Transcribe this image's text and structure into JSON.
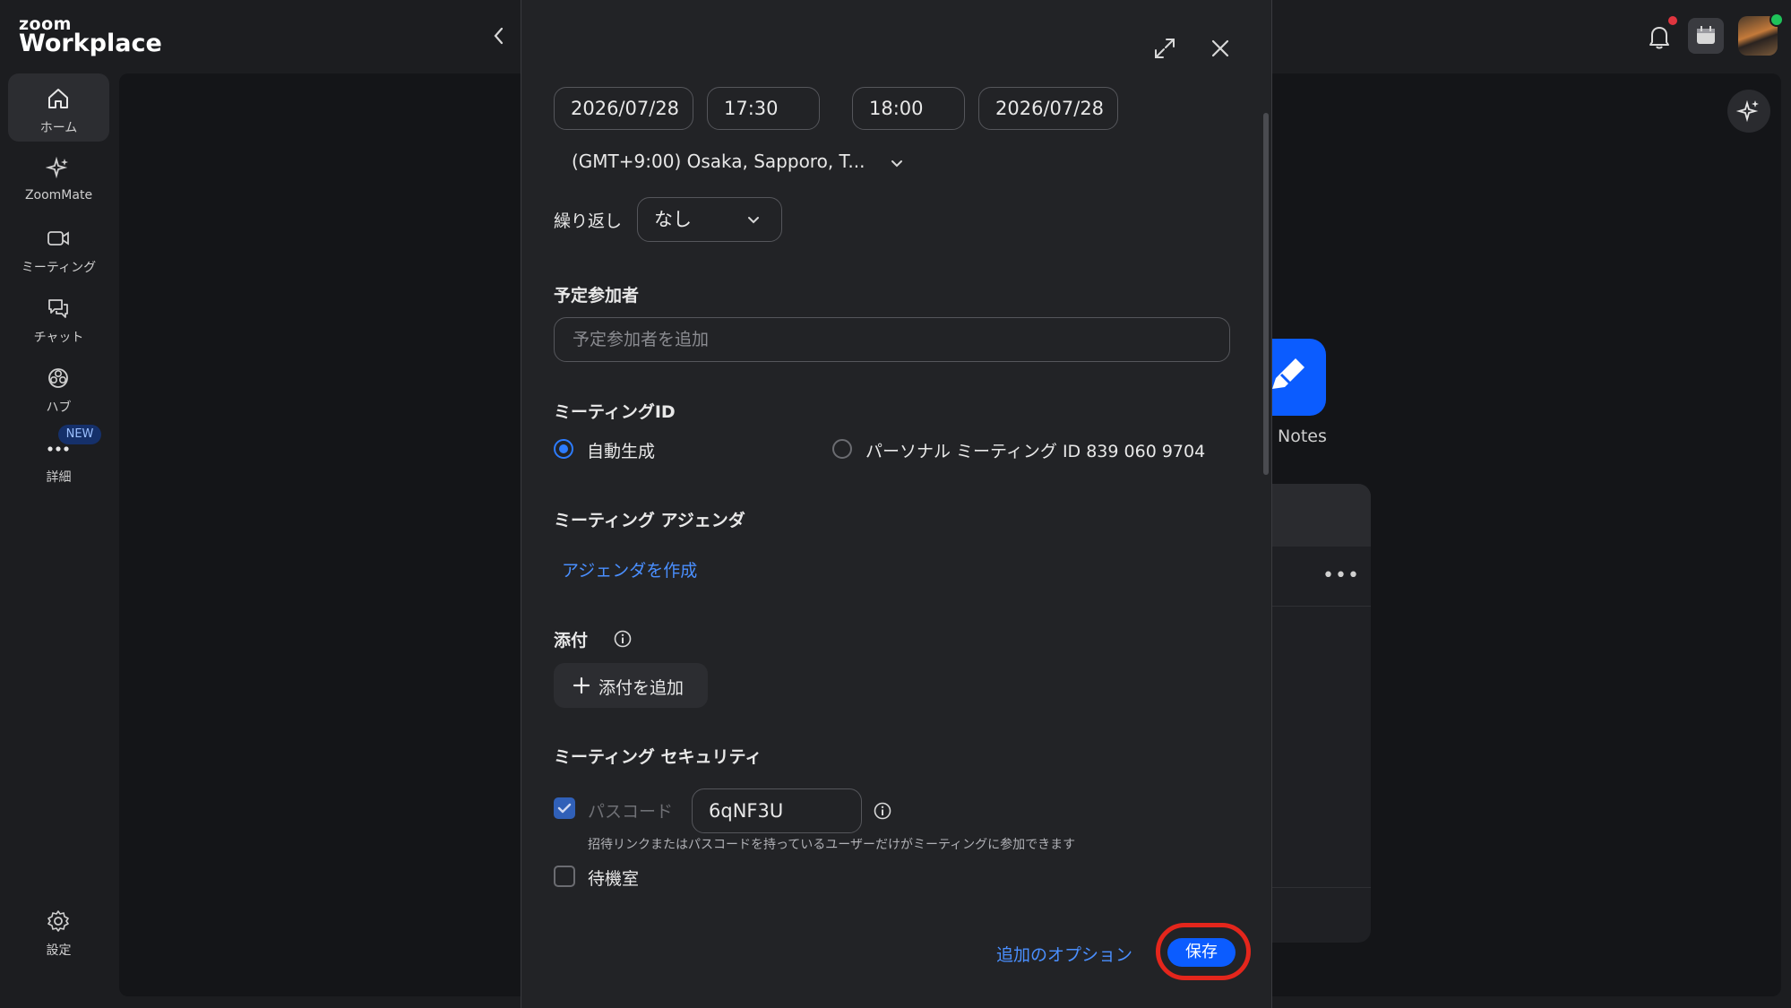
{
  "app": {
    "logo_top": "zoom",
    "logo_bottom": "Workplace"
  },
  "sidebar": {
    "items": [
      {
        "label": "ホーム",
        "icon": "home-icon"
      },
      {
        "label": "ZoomMate",
        "icon": "sparkle-icon"
      },
      {
        "label": "ミーティング",
        "icon": "video-icon"
      },
      {
        "label": "チャット",
        "icon": "chat-icon"
      },
      {
        "label": "ハブ",
        "icon": "hub-icon"
      },
      {
        "label": "詳細",
        "icon": "more-icon",
        "badge": "NEW"
      }
    ],
    "settings_label": "設定"
  },
  "background": {
    "notes_label": "Notes",
    "card_more": "•••"
  },
  "dialog": {
    "start_date": "2026/07/28",
    "start_time": "17:30",
    "end_time": "18:00",
    "end_date": "2026/07/28",
    "timezone": "(GMT+9:00) Osaka, Sapporo, T...",
    "recurrence_label": "繰り返し",
    "recurrence_value": "なし",
    "attendees_title": "予定参加者",
    "attendees_placeholder": "予定参加者を追加",
    "meeting_id_title": "ミーティングID",
    "meeting_id_auto": "自動生成",
    "meeting_id_personal": "パーソナル ミーティング ID 839 060 9704",
    "agenda_title": "ミーティング アジェンダ",
    "agenda_link": "アジェンダを作成",
    "attachments_title": "添付",
    "add_attachment": "添付を追加",
    "security_title": "ミーティング セキュリティ",
    "passcode_label": "パスコード",
    "passcode_value": "6qNF3U",
    "passcode_hint": "招待リンクまたはパスコードを持っているユーザーだけがミーティングに参加できます",
    "waiting_room_label": "待機室",
    "more_options": "追加のオプション",
    "save": "保存"
  },
  "colors": {
    "accent": "#0b5cff",
    "link": "#4a8fff",
    "highlight_ring": "#e4261c"
  }
}
